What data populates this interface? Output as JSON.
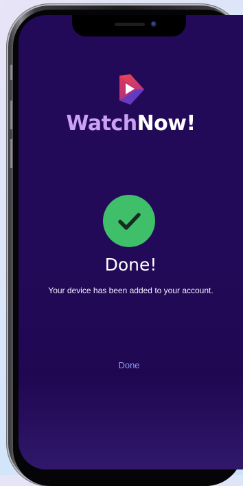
{
  "app": {
    "brand_part1": "Watch",
    "brand_part2": "Now!",
    "logo_icon": "play-logo-icon"
  },
  "success": {
    "icon": "checkmark-icon",
    "title": "Done!",
    "message": "Your device has been added to your account.",
    "button_label": "Done"
  },
  "colors": {
    "background": "#230a58",
    "brand_accent": "#c9a2f4",
    "success_green": "#3fbf6a",
    "link_blue": "#8f9ef0"
  }
}
